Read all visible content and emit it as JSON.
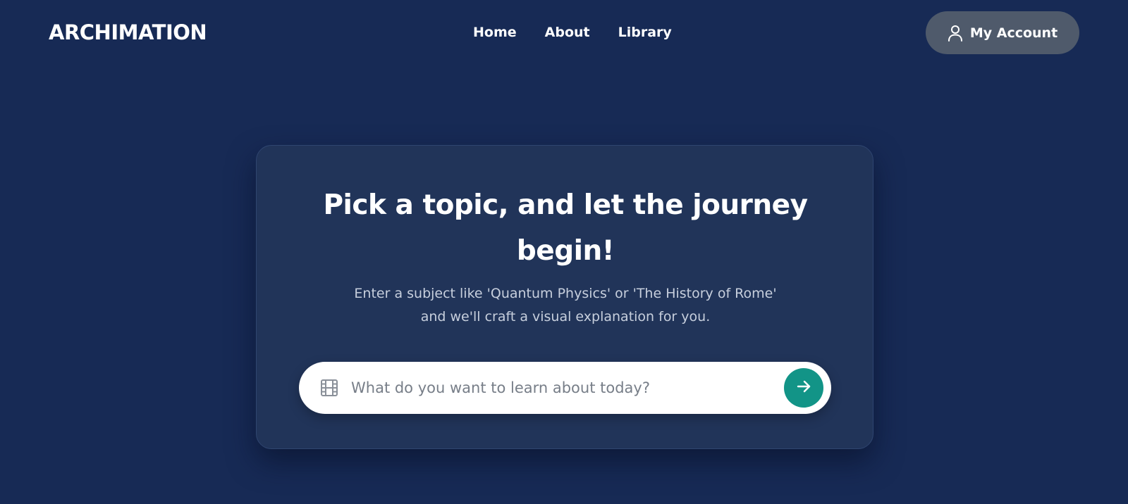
{
  "app": {
    "logo": "ARCHIMATION"
  },
  "nav": {
    "items": [
      {
        "label": "Home"
      },
      {
        "label": "About"
      },
      {
        "label": "Library"
      }
    ]
  },
  "account": {
    "label": "My Account",
    "icon": "user-icon"
  },
  "hero": {
    "headline": "Pick a topic, and let the journey begin!",
    "subtext": "Enter a subject like 'Quantum Physics' or 'The History of Rome' and we'll craft a visual explanation for you."
  },
  "search": {
    "placeholder": "What do you want to learn about today?",
    "value": "",
    "leading_icon": "film-icon",
    "submit_icon": "arrow-right-icon"
  },
  "colors": {
    "background": "#172a55",
    "card": "#213459",
    "accent": "#129487",
    "account_button": "#4f5a6b"
  }
}
